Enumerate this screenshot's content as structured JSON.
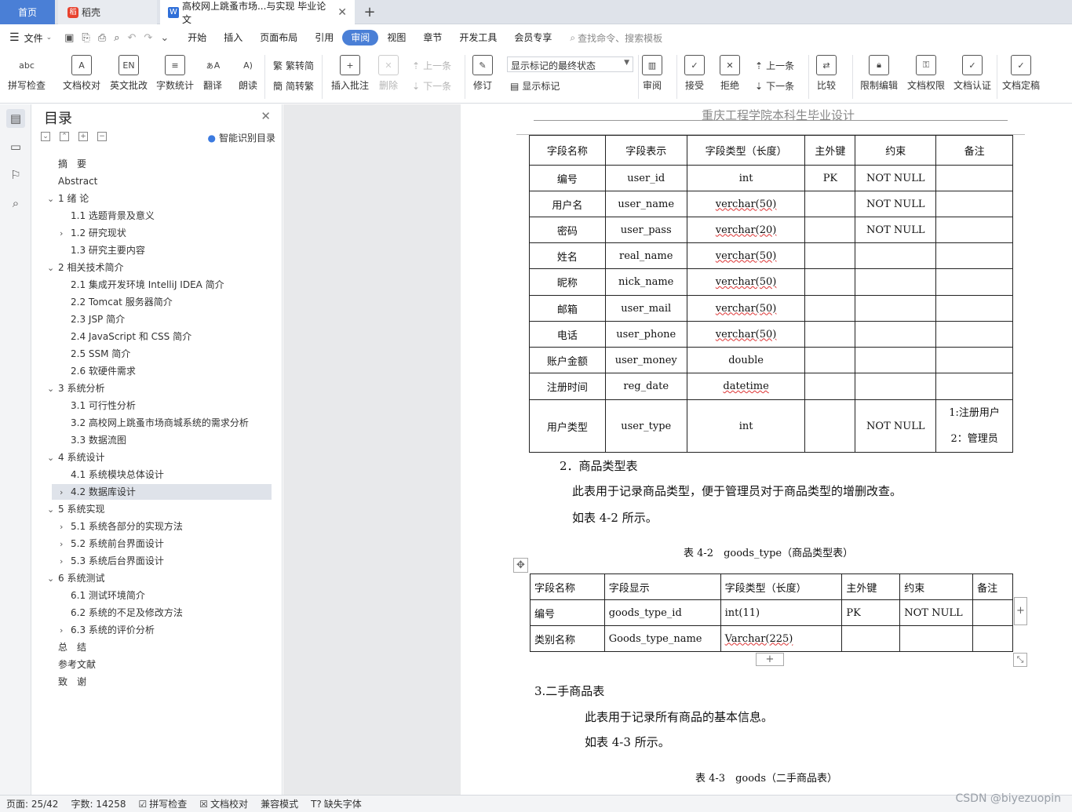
{
  "tabs": {
    "home": "首页",
    "daoke": "稻壳",
    "doc": "高校网上跳蚤市场...与实现 毕业论文"
  },
  "menu": {
    "file": "文件",
    "items": [
      "开始",
      "插入",
      "页面布局",
      "引用",
      "审阅",
      "视图",
      "章节",
      "开发工具",
      "会员专享"
    ],
    "active": "审阅",
    "search": "查找命令、搜索模板"
  },
  "ribbon": {
    "spell": "拼写检查",
    "proof": "文档校对",
    "en_review": "英文批改",
    "word_count": "字数统计",
    "translate": "翻译",
    "read": "朗读",
    "trad": "繁转简",
    "simp": "简转繁",
    "insert_comment": "插入批注",
    "delete": "删除",
    "prev": "上一条",
    "next": "下一条",
    "revise": "修订",
    "status_select": "显示标记的最终状态",
    "show_marks": "显示标记",
    "review": "审阅",
    "accept": "接受",
    "reject": "拒绝",
    "prev2": "上一条",
    "next2": "下一条",
    "compare": "比较",
    "restrict": "限制编辑",
    "permission": "文档权限",
    "certify": "文档认证",
    "finalize": "文档定稿"
  },
  "nav": {
    "title": "目录",
    "smart": "智能识别目录",
    "items": [
      "摘　要",
      "Abstract",
      "1 绪 论",
      "1.1 选题背景及意义",
      "1.2 研究现状",
      "1.3 研究主要内容",
      "2 相关技术简介",
      "2.1 集成开发环境 IntelliJ IDEA 简介",
      "2.2 Tomcat 服务器简介",
      "2.3 JSP 简介",
      "2.4 JavaScript 和 CSS 简介",
      "2.5 SSM 简介",
      "2.6 软硬件需求",
      "3 系统分析",
      "3.1 可行性分析",
      "3.2 高校网上跳蚤市场商城系统的需求分析",
      "3.3 数据流图",
      "4 系统设计",
      "4.1 系统模块总体设计",
      "4.2 数据库设计",
      "5 系统实现",
      "5.1  系统各部分的实现方法",
      "5.2  系统前台界面设计",
      "5.3 系统后台界面设计",
      "6 系统测试",
      "6.1 测试环境简介",
      "6.2 系统的不足及修改方法",
      "6.3  系统的评价分析",
      "总　结",
      "参考文献",
      "致　谢"
    ]
  },
  "page": {
    "header": "重庆工程学院本科生毕业设计",
    "table1": {
      "headers": [
        "字段名称",
        "字段表示",
        "字段类型（长度）",
        "主外键",
        "约束",
        "备注"
      ],
      "rows": [
        [
          "编号",
          "user_id",
          "int",
          "PK",
          "NOT NULL",
          ""
        ],
        [
          "用户名",
          "user_name",
          "verchar(50)",
          "",
          "NOT NULL",
          ""
        ],
        [
          "密码",
          "user_pass",
          "verchar(20)",
          "",
          "NOT NULL",
          ""
        ],
        [
          "姓名",
          "real_name",
          "verchar(50)",
          "",
          "",
          ""
        ],
        [
          "昵称",
          "nick_name",
          "verchar(50)",
          "",
          "",
          ""
        ],
        [
          "邮箱",
          "user_mail",
          "verchar(50)",
          "",
          "",
          ""
        ],
        [
          "电话",
          "user_phone",
          "verchar(50)",
          "",
          "",
          ""
        ],
        [
          "账户金额",
          "user_money",
          "double",
          "",
          "",
          ""
        ],
        [
          "注册时间",
          "reg_date",
          "datetime",
          "",
          "",
          ""
        ],
        [
          "用户类型",
          "user_type",
          "int",
          "",
          "NOT NULL",
          "1:注册用户"
        ]
      ],
      "last_note2": "2：管理员"
    },
    "sec2_title": "2．商品类型表",
    "sec2_p1": "此表用于记录商品类型，便于管理员对于商品类型的增删改查。",
    "sec2_p2": "如表 4-2 所示。",
    "cap2": "表 4-2　goods_type（商品类型表）",
    "table2": {
      "headers": [
        "字段名称",
        "字段显示",
        "字段类型（长度）",
        "主外键",
        "约束",
        "备注"
      ],
      "rows": [
        [
          "编号",
          "goods_type_id",
          "int(11)",
          "PK",
          "NOT NULL",
          ""
        ],
        [
          "类别名称",
          "Goods_type_name",
          "Varchar(225)",
          "",
          "",
          ""
        ]
      ]
    },
    "sec3_title": "3.二手商品表",
    "sec3_p1": "此表用于记录所有商品的基本信息。",
    "sec3_p2": "如表 4-3 所示。",
    "cap3": "表 4-3　goods（二手商品表）"
  },
  "status": {
    "page": "页面: 25/42",
    "words": "字数: 14258",
    "spell": "拼写检查",
    "proof": "文档校对",
    "compat": "兼容模式",
    "missing_font": "缺失字体"
  },
  "watermark": "CSDN @biyezuopin"
}
